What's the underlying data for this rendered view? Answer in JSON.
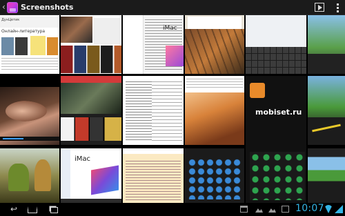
{
  "actionbar": {
    "title": "Screenshots",
    "back_icon": "chevron-left-icon",
    "app_icon": "gallery-app-icon",
    "actions": [
      {
        "name": "slideshow",
        "icon": "slideshow-icon"
      },
      {
        "name": "overflow",
        "icon": "overflow-menu-icon"
      }
    ]
  },
  "grid": {
    "t1": {
      "header": "ДунЦетик",
      "title": "Онлайн-литература"
    },
    "t6": {
      "imac": "iMac"
    },
    "t7": {
      "imac": "iMac"
    },
    "t14": {
      "watermark": "mobiset.ru"
    }
  },
  "systembar": {
    "clock": "10:07",
    "accent": "#33b5e5",
    "nav": [
      {
        "name": "back",
        "icon": "back-arrow-icon"
      },
      {
        "name": "home",
        "icon": "home-icon"
      },
      {
        "name": "recent-apps",
        "icon": "recent-apps-icon"
      }
    ]
  }
}
